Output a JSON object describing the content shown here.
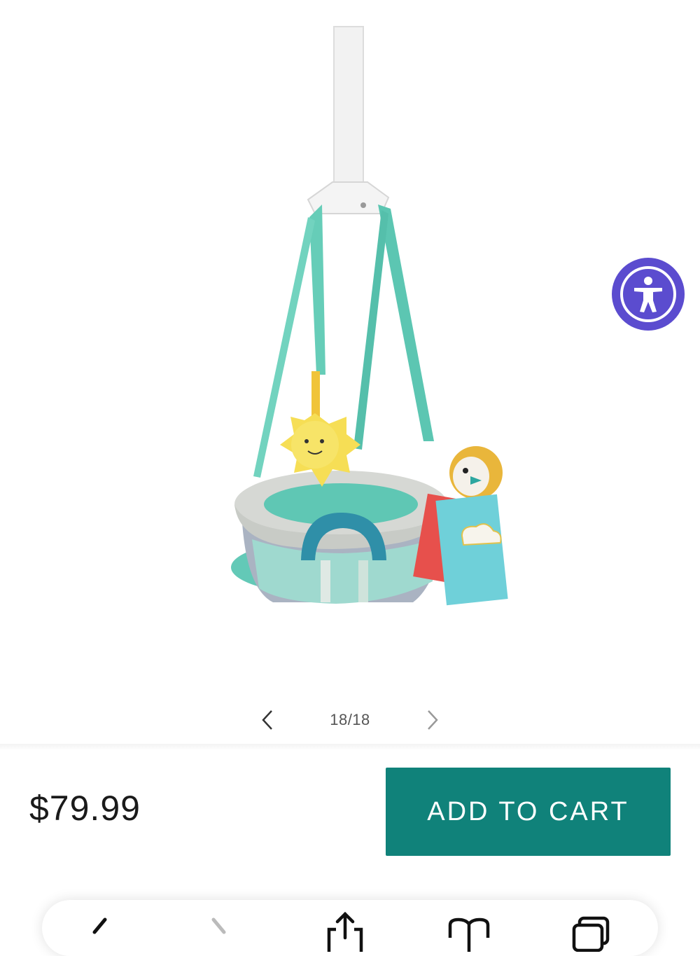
{
  "gallery": {
    "counter": "18/18",
    "prev_icon": "chevron-left-icon",
    "next_icon": "chevron-right-icon",
    "image_alt": "Baby doorway jumper with aqua straps, cloud print seat, sun and bird toys"
  },
  "accessibility": {
    "icon": "accessibility-person-icon",
    "color": "#5b4ccf"
  },
  "product": {
    "price": "$79.99"
  },
  "cart": {
    "label": "ADD TO CART",
    "color": "#10827a"
  },
  "browser_toolbar": {
    "icons": [
      "back-icon",
      "forward-icon",
      "share-icon",
      "bookmarks-icon",
      "tabs-icon"
    ]
  }
}
